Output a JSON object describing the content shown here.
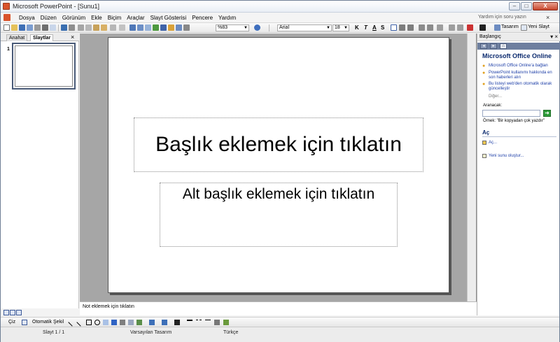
{
  "window": {
    "title": "Microsoft PowerPoint - [Sunu1]",
    "min_glyph": "–",
    "max_glyph": "□",
    "close_glyph": "X"
  },
  "menu": {
    "items": [
      "Dosya",
      "Düzen",
      "Görünüm",
      "Ekle",
      "Biçim",
      "Araçlar",
      "Slayt Gösterisi",
      "Pencere",
      "Yardım"
    ],
    "help_placeholder": "Yardım için soru yazın",
    "close_glyph": "×"
  },
  "toolbar": {
    "zoom": "%83",
    "font": "Arial",
    "font_size": "18",
    "bold": "K",
    "italic": "T",
    "underline": "A",
    "shadow": "S",
    "design_label": "Tasarım",
    "new_slide_label": "Yeni Slayt"
  },
  "left_panel": {
    "tab_outline": "Anahat",
    "tab_slides": "Slaytlar",
    "close_glyph": "×",
    "slide_number": "1"
  },
  "slide": {
    "title_placeholder": "Başlık eklemek için tıklatın",
    "subtitle_placeholder": "Alt başlık eklemek için tıklatın"
  },
  "notes": {
    "placeholder": "Not eklemek için tıklatın"
  },
  "task_pane": {
    "title": "Başlangıç",
    "section": "Microsoft Office Online",
    "links": [
      "Microsoft Office Online'a bağlan",
      "PowerPoint kullanımı hakkında en son haberleri alın",
      "Bu listeyi web'den otomatik olarak güncelleştir"
    ],
    "more": "Diğer...",
    "search_label": "Aranacak:",
    "example": "Örnek: \"Bir kopyadan çok yazdır\"",
    "open_heading": "Aç",
    "open_link": "Aç...",
    "new_presentation": "Yeni sunu oluştur..."
  },
  "drawing_toolbar": {
    "draw_label": "Çiz",
    "autoshapes_label": "Otomatik Şekil"
  },
  "status": {
    "slide": "Slayt 1 / 1",
    "design": "Varsayılan Tasarım",
    "language": "Türkçe"
  }
}
